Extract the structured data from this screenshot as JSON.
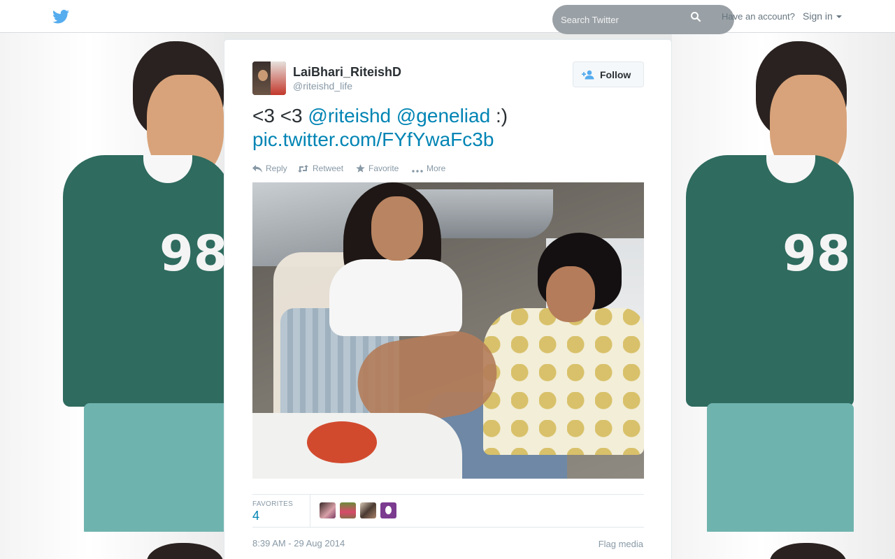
{
  "header": {
    "search_placeholder": "Search Twitter",
    "have_account": "Have an account?",
    "signin_label": "Sign in"
  },
  "tweet": {
    "fullname": "LaiBhari_RiteishD",
    "username": "@riteishd_life",
    "follow_label": "Follow",
    "text_prefix": "<3 <3 ",
    "mention1": "@riteishd",
    "mention2": "@geneliad",
    "text_suffix": " :)",
    "link": "pic.twitter.com/FYfYwaFc3b",
    "actions": {
      "reply": "Reply",
      "retweet": "Retweet",
      "favorite": "Favorite",
      "more": "More"
    },
    "stats": {
      "favorites_label": "FAVORITES",
      "favorites_count": "4"
    },
    "timestamp": "8:39 AM - 29 Aug 2014",
    "flag_media": "Flag media"
  },
  "colors": {
    "link": "#0084b4",
    "mention_at": "#55acee",
    "logo": "#55acee",
    "muted": "#8899a6"
  },
  "icons": [
    "twitter-bird-icon",
    "search-icon",
    "follow-user-icon",
    "reply-icon",
    "retweet-icon",
    "favorite-star-icon",
    "more-dots-icon"
  ]
}
